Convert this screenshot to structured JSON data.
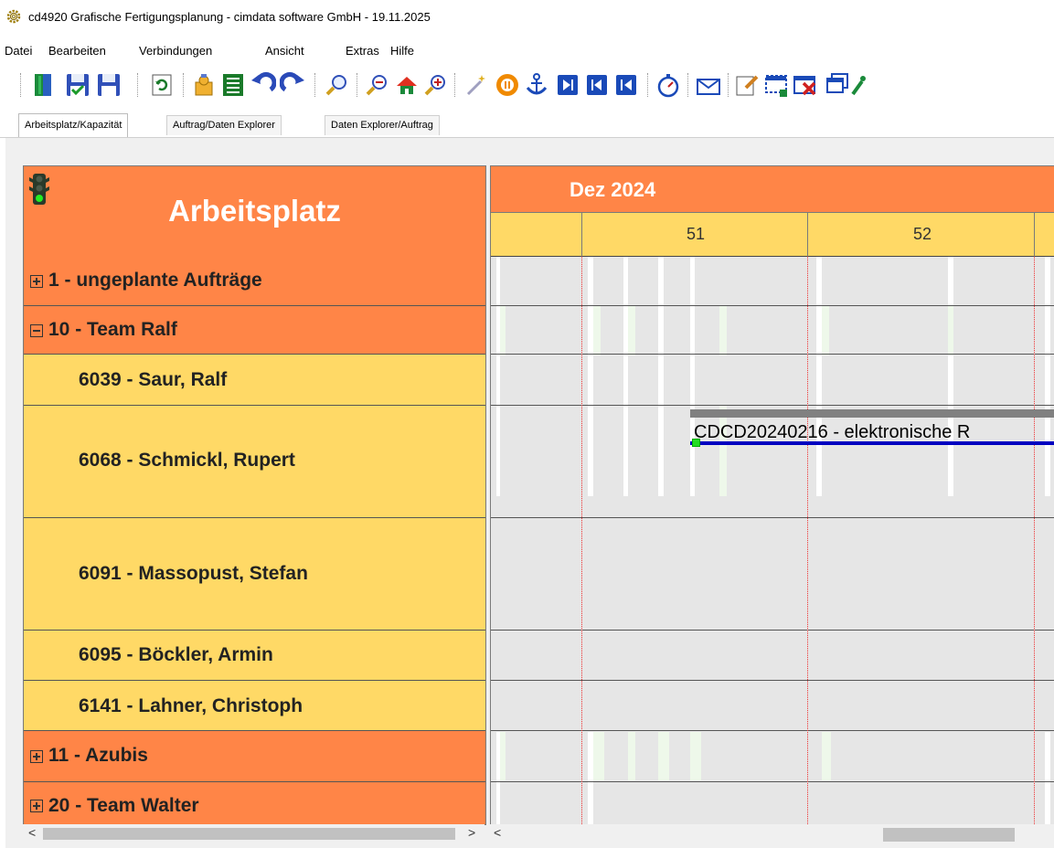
{
  "window": {
    "title": "cd4920 Grafische Fertigungsplanung - cimdata software GmbH - 19.11.2025"
  },
  "menu": [
    "Datei",
    "Bearbeiten",
    "Verbindungen",
    "Ansicht",
    "Extras",
    "Hilfe"
  ],
  "toolbar": {
    "icons": [
      "exit-door-icon",
      "save-check-icon",
      "save-icon",
      "refresh-icon",
      "settings-puzzle-icon",
      "list-icon",
      "undo-icon",
      "redo-icon",
      "search-icon",
      "zoom-out-icon",
      "home-icon",
      "zoom-in-icon",
      "magic-wand-icon",
      "stop-icon",
      "anchor-icon",
      "last-icon",
      "first-icon",
      "start-icon",
      "stopwatch-icon",
      "mail-icon",
      "edit-note-icon",
      "select-icon",
      "delete-icon",
      "windows-icon",
      "more-icon"
    ]
  },
  "tabs": [
    "Arbeitsplatz/Kapazität",
    "Auftrag/Daten Explorer",
    "Daten Explorer/Auftrag"
  ],
  "active_tab": 0,
  "left_panel": {
    "header": "Arbeitsplatz",
    "status_icon": "traffic-light-icon",
    "rows": [
      {
        "type": "group",
        "expander": "plus",
        "label": "1 - ungeplante Aufträge"
      },
      {
        "type": "group",
        "expander": "minus",
        "label": "10 - Team Ralf"
      },
      {
        "type": "person",
        "label": "6039 - Saur, Ralf"
      },
      {
        "type": "person",
        "label": "6068 - Schmickl, Rupert"
      },
      {
        "type": "person",
        "label": "6091 - Massopust, Stefan"
      },
      {
        "type": "person",
        "label": "6095 - Böckler, Armin"
      },
      {
        "type": "person",
        "label": "6141 - Lahner, Christoph"
      },
      {
        "type": "group",
        "expander": "plus",
        "label": "11 - Azubis"
      },
      {
        "type": "group",
        "expander": "plus",
        "label": "20 - Team Walter"
      }
    ]
  },
  "right_panel": {
    "month": "Dez 2024",
    "weeks": [
      "51",
      "52"
    ]
  },
  "gantt_bar": {
    "label": "CDCD20240216 - elektronische R"
  },
  "scrollbars": {
    "left_arrow": "<",
    "right_arrow": ">"
  },
  "colors": {
    "group_bg": "#ff8547",
    "person_bg": "#ffd966",
    "grid_bg": "#e6e6e6",
    "bar_line": "#0000c0"
  }
}
